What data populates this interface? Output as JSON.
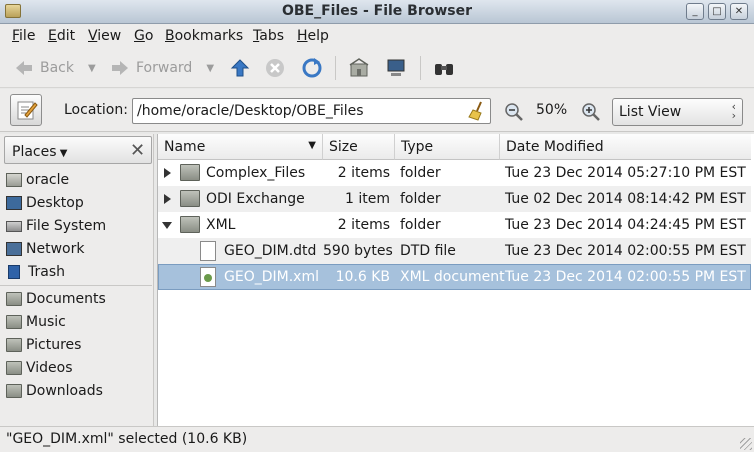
{
  "window": {
    "title": "OBE_Files - File Browser"
  },
  "menu": {
    "items": [
      {
        "mnemonic": "F",
        "rest": "ile"
      },
      {
        "mnemonic": "E",
        "rest": "dit"
      },
      {
        "mnemonic": "V",
        "rest": "iew"
      },
      {
        "mnemonic": "G",
        "rest": "o"
      },
      {
        "mnemonic": "B",
        "rest": "ookmarks"
      },
      {
        "mnemonic": "T",
        "rest": "abs"
      },
      {
        "mnemonic": "H",
        "rest": "elp"
      }
    ]
  },
  "toolbar": {
    "back_label": "Back",
    "forward_label": "Forward"
  },
  "location": {
    "label": "Location:",
    "value": "/home/oracle/Desktop/OBE_Files",
    "zoom": "50%",
    "view_mode": "List View"
  },
  "sidebar": {
    "header": "Places",
    "items": [
      {
        "label": "oracle",
        "icon": "home-icon"
      },
      {
        "label": "Desktop",
        "icon": "desktop-icon"
      },
      {
        "label": "File System",
        "icon": "drive-icon"
      },
      {
        "label": "Network",
        "icon": "network-icon"
      },
      {
        "label": "Trash",
        "icon": "trash-icon"
      },
      {
        "label": "Documents",
        "icon": "folder-icon"
      },
      {
        "label": "Music",
        "icon": "folder-icon"
      },
      {
        "label": "Pictures",
        "icon": "folder-icon"
      },
      {
        "label": "Videos",
        "icon": "folder-icon"
      },
      {
        "label": "Downloads",
        "icon": "folder-icon"
      }
    ]
  },
  "files": {
    "columns": {
      "name": "Name",
      "size": "Size",
      "type": "Type",
      "date": "Date Modified"
    },
    "rows": [
      {
        "name": "Complex_Files",
        "size": "2 items",
        "type": "folder",
        "date": "Tue 23 Dec 2014 05:27:10 PM EST"
      },
      {
        "name": "ODI Exchange",
        "size": "1 item",
        "type": "folder",
        "date": "Tue 02 Dec 2014 08:14:42 PM EST"
      },
      {
        "name": "XML",
        "size": "2 items",
        "type": "folder",
        "date": "Tue 23 Dec 2014 04:24:45 PM EST"
      },
      {
        "name": "GEO_DIM.dtd",
        "size": "590 bytes",
        "type": "DTD file",
        "date": "Tue 23 Dec 2014 02:00:55 PM EST"
      },
      {
        "name": "GEO_DIM.xml",
        "size": "10.6 KB",
        "type": "XML document",
        "date": "Tue 23 Dec 2014 02:00:55 PM EST"
      }
    ]
  },
  "status": {
    "text": "\"GEO_DIM.xml\" selected (10.6 KB)"
  },
  "colors": {
    "selection": "#a6c1dc",
    "titlebar": "#b9c6d4"
  }
}
